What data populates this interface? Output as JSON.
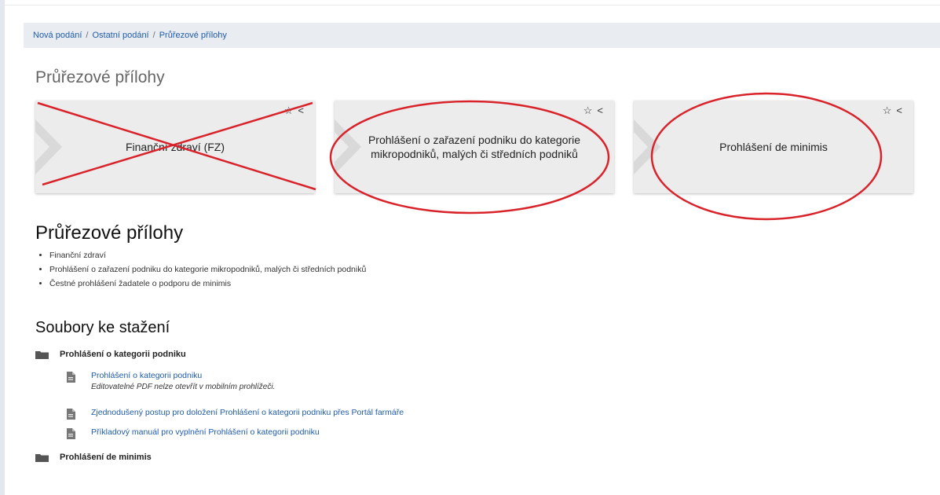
{
  "breadcrumb": [
    "Nová podání",
    "Ostatní podání",
    "Průřezové přílohy"
  ],
  "page_title": "Průřezové přílohy",
  "tiles": [
    {
      "label": "Finanční zdraví (FZ)",
      "annotation": "crossed-out"
    },
    {
      "label": "Prohlášení o zařazení podniku do kategorie mikropodniků, malých či středních podniků",
      "annotation": "circled"
    },
    {
      "label": "Prohlášení de minimis",
      "annotation": "circled"
    }
  ],
  "tile_tools": {
    "favorite": "☆",
    "collapse": "<"
  },
  "section_title": "Průřezové přílohy",
  "bullets": [
    "Finanční zdraví",
    "Prohlášení o zařazení podniku do kategorie mikropodniků, malých či středních podniků",
    "Čestné prohlášení žadatele o podporu de minimis"
  ],
  "downloads_title": "Soubory ke stažení",
  "folders": [
    {
      "name": "Prohlášení o kategorii podniku",
      "files": [
        {
          "name": "Prohlášení o kategorii podniku",
          "note": "Editovatelné PDF nelze otevřít v mobilním prohlížeči."
        },
        {
          "name": "Zjednodušený postup pro doložení Prohlášení o kategorii podniku přes Portál farmáře",
          "note": ""
        },
        {
          "name": "Příkladový manuál pro vyplnění Prohlášení o kategorii podniku",
          "note": ""
        }
      ]
    },
    {
      "name": "Prohlášení de minimis",
      "files": []
    }
  ],
  "colors": {
    "link": "#1f5ca8",
    "annotation": "#d8232a",
    "tile_bg": "#ececec",
    "breadcrumb_bg": "#e9ecf1"
  }
}
